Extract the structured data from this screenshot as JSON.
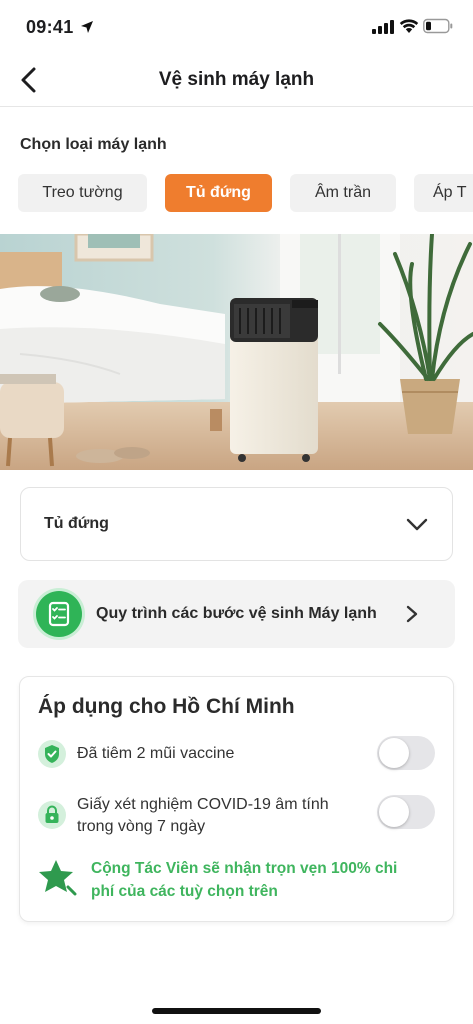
{
  "status": {
    "time": "09:41"
  },
  "nav": {
    "title": "Vệ sinh máy lạnh"
  },
  "selector": {
    "label": "Chọn loại máy lạnh",
    "chips": [
      {
        "label": "Treo tường",
        "active": false
      },
      {
        "label": "Tủ đứng",
        "active": true
      },
      {
        "label": "Âm trần",
        "active": false
      },
      {
        "label": "Áp T",
        "active": false
      }
    ]
  },
  "dropdown": {
    "value": "Tủ đứng"
  },
  "procedure": {
    "label": "Quy trình các bước vệ sinh Máy lạnh"
  },
  "apply": {
    "title": "Áp dụng cho Hồ Chí Minh",
    "options": [
      {
        "text": "Đã tiêm 2 mũi vaccine",
        "enabled": false
      },
      {
        "text_line1": "Giấy xét nghiệm COVID-19 âm tính",
        "text_line2": "trong vòng 7 ngày",
        "enabled": false
      }
    ],
    "bonus_line1": "Cộng Tác Viên sẽ nhận trọn vẹn 100% chi",
    "bonus_line2": "phí của các tuỳ chọn trên"
  },
  "colors": {
    "accent": "#ef7d2e",
    "green": "#2fb457",
    "bonus_text": "#3fb55e",
    "toggle_off": "#e5e5e8"
  },
  "icons": {
    "back": "chevron-left-icon",
    "dropdown": "chevron-down-icon",
    "procedure": "checklist-icon",
    "vaccine": "shield-check-icon",
    "test": "lock-check-icon",
    "bonus": "star-icon"
  }
}
